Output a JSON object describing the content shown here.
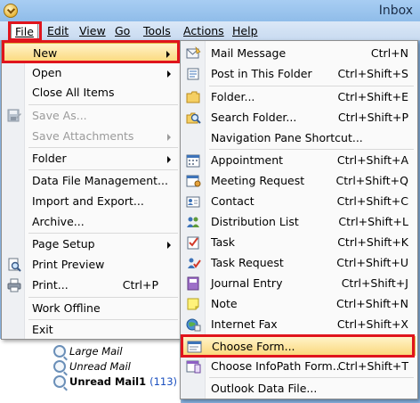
{
  "window": {
    "title": "Inbox"
  },
  "menubar": {
    "items": [
      {
        "label": "File",
        "key": "F"
      },
      {
        "label": "Edit",
        "key": "E"
      },
      {
        "label": "View",
        "key": "V"
      },
      {
        "label": "Go",
        "key": "G"
      },
      {
        "label": "Tools",
        "key": "T"
      },
      {
        "label": "Actions",
        "key": "A"
      },
      {
        "label": "Help",
        "key": "H"
      }
    ]
  },
  "file_menu": {
    "new": "New",
    "open": "Open",
    "close_all": "Close All Items",
    "save_as": "Save As...",
    "save_attachments": "Save Attachments",
    "folder": "Folder",
    "data_file_management": "Data File Management...",
    "import_export": "Import and Export...",
    "archive": "Archive...",
    "page_setup": "Page Setup",
    "print_preview": "Print Preview",
    "print": "Print...",
    "print_shortcut": "Ctrl+P",
    "work_offline": "Work Offline",
    "exit": "Exit"
  },
  "new_menu": {
    "items": [
      {
        "label": "Mail Message",
        "shortcut": "Ctrl+N",
        "icon": "mail-message-icon"
      },
      {
        "label": "Post in This Folder",
        "shortcut": "Ctrl+Shift+S",
        "icon": "post-icon"
      },
      {
        "label": "Folder...",
        "shortcut": "Ctrl+Shift+E",
        "icon": "folder-icon"
      },
      {
        "label": "Search Folder...",
        "shortcut": "Ctrl+Shift+P",
        "icon": "search-folder-icon"
      },
      {
        "label": "Navigation Pane Shortcut...",
        "shortcut": "",
        "icon": ""
      },
      {
        "label": "Appointment",
        "shortcut": "Ctrl+Shift+A",
        "icon": "calendar-icon"
      },
      {
        "label": "Meeting Request",
        "shortcut": "Ctrl+Shift+Q",
        "icon": "meeting-request-icon"
      },
      {
        "label": "Contact",
        "shortcut": "Ctrl+Shift+C",
        "icon": "contact-card-icon"
      },
      {
        "label": "Distribution List",
        "shortcut": "Ctrl+Shift+L",
        "icon": "distribution-list-icon"
      },
      {
        "label": "Task",
        "shortcut": "Ctrl+Shift+K",
        "icon": "task-icon"
      },
      {
        "label": "Task Request",
        "shortcut": "Ctrl+Shift+U",
        "icon": "task-request-icon"
      },
      {
        "label": "Journal Entry",
        "shortcut": "Ctrl+Shift+J",
        "icon": "journal-icon"
      },
      {
        "label": "Note",
        "shortcut": "Ctrl+Shift+N",
        "icon": "note-icon"
      },
      {
        "label": "Internet Fax",
        "shortcut": "Ctrl+Shift+X",
        "icon": "internet-fax-icon"
      },
      {
        "label": "Choose Form...",
        "shortcut": "",
        "icon": "choose-form-icon"
      },
      {
        "label": "Choose InfoPath Form...",
        "shortcut": "Ctrl+Shift+T",
        "icon": "infopath-form-icon"
      },
      {
        "label": "Outlook Data File...",
        "shortcut": "",
        "icon": ""
      }
    ]
  },
  "folder_tree": {
    "large_mail": "Large Mail",
    "unread_mail": "Unread Mail",
    "unread_mail1": "Unread Mail1",
    "unread_mail1_count": "(113)"
  },
  "colors": {
    "highlight_red": "#e0141c",
    "menu_hover": "#fbd97d",
    "titlebar": "#a8cdf3"
  }
}
